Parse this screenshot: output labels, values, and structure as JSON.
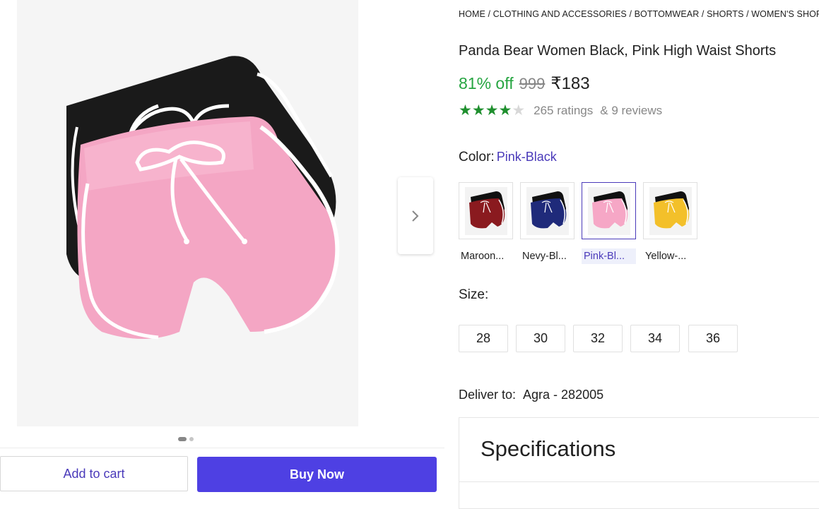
{
  "breadcrumb": [
    "HOME",
    "CLOTHING AND ACCESSORIES",
    "BOTTOMWEAR",
    "SHORTS",
    "WOMEN'S SHORTS"
  ],
  "product": {
    "title": "Panda Bear Women Black, Pink High Waist Shorts",
    "discount": "81% off",
    "mrp": "999",
    "price": "₹183",
    "rating_stars": 4,
    "ratings_text": "265 ratings",
    "reviews_text": "& 9 reviews"
  },
  "color": {
    "label": "Color:",
    "selected": "Pink-Black",
    "options": [
      {
        "label": "Maroon...",
        "primary": "#8a1a1f",
        "secondary": "#111111"
      },
      {
        "label": "Nevy-Bl...",
        "primary": "#1f2a7a",
        "secondary": "#111111"
      },
      {
        "label": "Pink-Bl...",
        "primary": "#f6a7c6",
        "secondary": "#111111"
      },
      {
        "label": "Yellow-...",
        "primary": "#f3c02a",
        "secondary": "#111111"
      }
    ]
  },
  "size": {
    "label": "Size:",
    "options": [
      "28",
      "30",
      "32",
      "34",
      "36"
    ]
  },
  "delivery": {
    "label": "Deliver to:",
    "value": "Agra - 282005"
  },
  "specifications": {
    "title": "Specifications"
  },
  "actions": {
    "add_to_cart": "Add to cart",
    "buy_now": "Buy Now"
  },
  "gallery": {
    "active_index": 0,
    "count": 2
  },
  "colors": {
    "accent": "#4e40e3",
    "discount_green": "#26a541",
    "star_green": "#1f8f2e"
  }
}
